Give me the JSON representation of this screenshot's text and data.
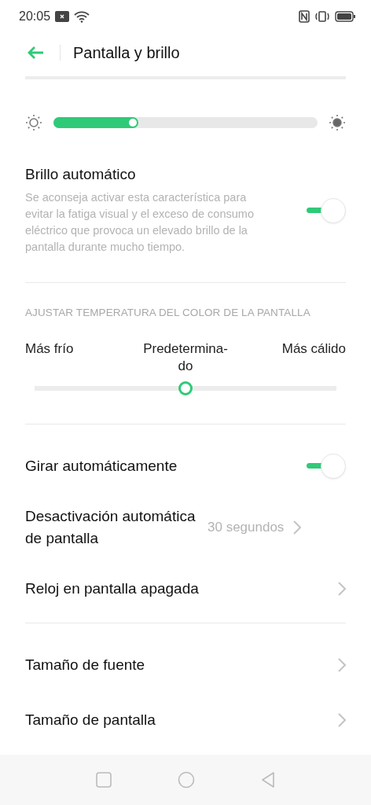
{
  "status_bar": {
    "time": "20:05"
  },
  "header": {
    "title": "Pantalla y brillo"
  },
  "auto_brightness": {
    "title": "Brillo automático",
    "description": "Se aconseja activar esta característica para evitar la fatiga visual y el exceso de consumo eléctrico que provoca un elevado brillo de la pantalla durante mucho tiempo.",
    "on": true
  },
  "color_temperature": {
    "heading": "AJUSTAR TEMPERATURA DEL COLOR DE LA PANTALLA",
    "labels": [
      "Más frío",
      "Predetermina-do",
      "Más cálido"
    ],
    "level": 0.5
  },
  "settings": [
    {
      "kind": "toggle",
      "label": "Girar automáticamente",
      "on": true
    },
    {
      "kind": "link",
      "label": "Desactivación automática de pantalla",
      "value": "30 segundos"
    },
    {
      "kind": "link",
      "label": "Reloj en pantalla apagada"
    },
    {
      "kind": "divider"
    },
    {
      "kind": "link",
      "label": "Tamaño de fuente"
    },
    {
      "kind": "link",
      "label": "Tamaño de pantalla"
    }
  ]
}
